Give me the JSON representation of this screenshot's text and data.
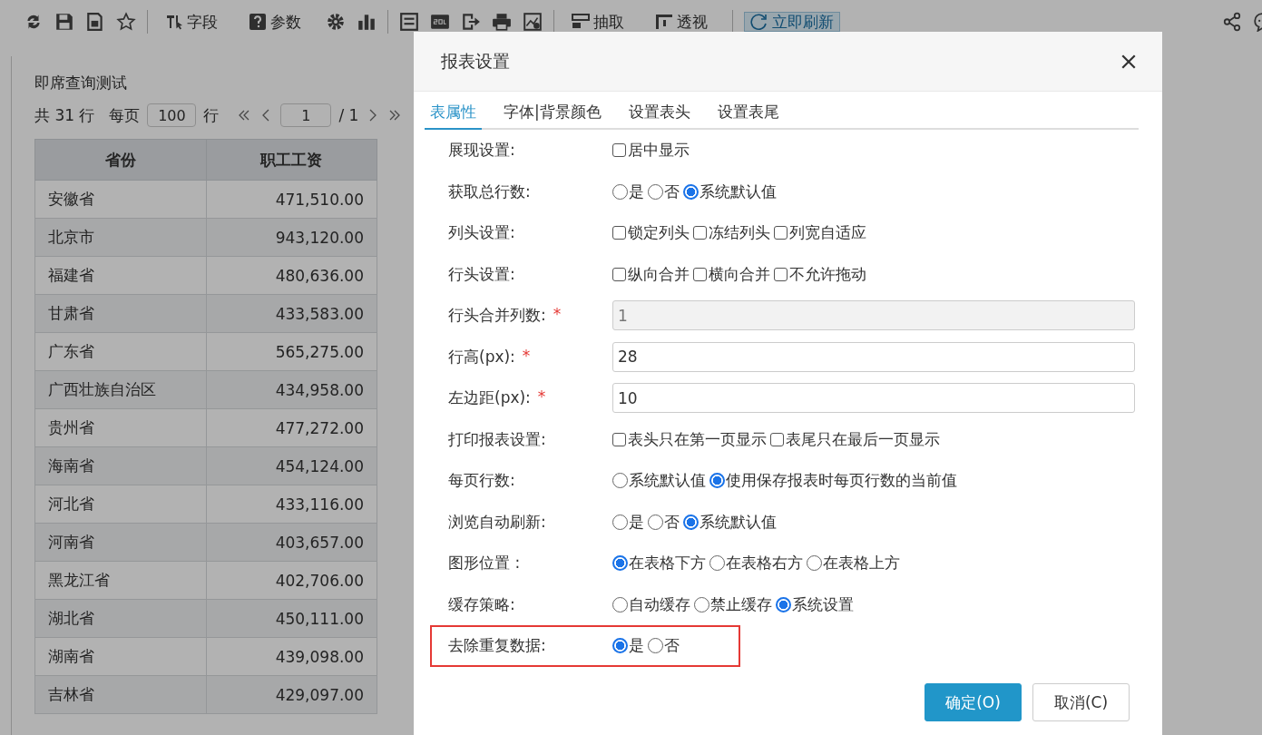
{
  "toolbar": {
    "buttons": [
      {
        "label": "字段",
        "active": false
      },
      {
        "label": "参数",
        "active": false
      },
      {
        "label": "抽取",
        "active": false
      },
      {
        "label": "透视",
        "active": false
      },
      {
        "label": "立即刷新",
        "active": true
      }
    ]
  },
  "report": {
    "title": "即席查询测试",
    "pager": {
      "total": "共 31 行",
      "per_page_label": "每页",
      "per_page": "100",
      "rows_unit": "行",
      "page": "1",
      "page_count": "/ 1"
    },
    "columns": [
      "省份",
      "职工工资"
    ],
    "rows": [
      [
        "安徽省",
        "471,510.00"
      ],
      [
        "北京市",
        "943,120.00"
      ],
      [
        "福建省",
        "480,636.00"
      ],
      [
        "甘肃省",
        "433,583.00"
      ],
      [
        "广东省",
        "565,275.00"
      ],
      [
        "广西壮族自治区",
        "434,958.00"
      ],
      [
        "贵州省",
        "477,272.00"
      ],
      [
        "海南省",
        "454,124.00"
      ],
      [
        "河北省",
        "433,116.00"
      ],
      [
        "河南省",
        "403,657.00"
      ],
      [
        "黑龙江省",
        "402,706.00"
      ],
      [
        "湖北省",
        "450,111.00"
      ],
      [
        "湖南省",
        "439,098.00"
      ],
      [
        "吉林省",
        "429,097.00"
      ]
    ]
  },
  "dialog": {
    "title": "报表设置",
    "tabs": [
      {
        "label": "表属性",
        "selected": true
      },
      {
        "label": "字体|背景颜色",
        "selected": false
      },
      {
        "label": "设置表头",
        "selected": false
      },
      {
        "label": "设置表尾",
        "selected": false
      }
    ],
    "rows": [
      {
        "label": "展现设置:",
        "highlighted": false,
        "kind": "checkboxes",
        "options": [
          {
            "label": "居中显示",
            "checked": false
          }
        ]
      },
      {
        "label": "获取总行数:",
        "highlighted": false,
        "kind": "radios",
        "options": [
          {
            "label": "是",
            "checked": false
          },
          {
            "label": "否",
            "checked": false
          },
          {
            "label": "系统默认值",
            "checked": true
          }
        ]
      },
      {
        "label": "列头设置:",
        "highlighted": false,
        "kind": "checkboxes",
        "options": [
          {
            "label": "锁定列头",
            "checked": false
          },
          {
            "label": "冻结列头",
            "checked": false
          },
          {
            "label": "列宽自适应",
            "checked": false
          }
        ]
      },
      {
        "label": "行头设置:",
        "highlighted": false,
        "kind": "checkboxes",
        "options": [
          {
            "label": "纵向合并",
            "checked": false
          },
          {
            "label": "横向合并",
            "checked": false
          },
          {
            "label": "不允许拖动",
            "checked": false
          }
        ]
      },
      {
        "label": "行头合并列数:",
        "required_mark": "*",
        "highlighted": false,
        "kind": "input",
        "value": "1",
        "disabled": true
      },
      {
        "label": "行高(px):",
        "required_mark": "*",
        "highlighted": false,
        "kind": "input",
        "value": "28",
        "disabled": false
      },
      {
        "label": "左边距(px):",
        "required_mark": "*",
        "highlighted": false,
        "kind": "input",
        "value": "10",
        "disabled": false
      },
      {
        "label": "打印报表设置:",
        "highlighted": false,
        "kind": "checkboxes",
        "options": [
          {
            "label": "表头只在第一页显示",
            "checked": false
          },
          {
            "label": "表尾只在最后一页显示",
            "checked": false
          }
        ]
      },
      {
        "label": "每页行数:",
        "highlighted": false,
        "kind": "radios",
        "options": [
          {
            "label": "系统默认值",
            "checked": false
          },
          {
            "label": "使用保存报表时每页行数的当前值",
            "checked": true
          }
        ]
      },
      {
        "label": "浏览自动刷新:",
        "highlighted": false,
        "kind": "radios",
        "options": [
          {
            "label": "是",
            "checked": false
          },
          {
            "label": "否",
            "checked": false
          },
          {
            "label": "系统默认值",
            "checked": true
          }
        ]
      },
      {
        "label": "图形位置 :",
        "highlighted": false,
        "kind": "radios",
        "options": [
          {
            "label": "在表格下方",
            "checked": true
          },
          {
            "label": "在表格右方",
            "checked": false
          },
          {
            "label": "在表格上方",
            "checked": false
          }
        ]
      },
      {
        "label": "缓存策略:",
        "highlighted": false,
        "kind": "radios",
        "options": [
          {
            "label": "自动缓存",
            "checked": false
          },
          {
            "label": "禁止缓存",
            "checked": false
          },
          {
            "label": "系统设置",
            "checked": true
          }
        ]
      },
      {
        "label": "去除重复数据:",
        "highlighted": true,
        "kind": "radios",
        "options": [
          {
            "label": "是",
            "checked": true
          },
          {
            "label": "否",
            "checked": false
          }
        ]
      }
    ],
    "buttons": [
      {
        "label": "确定(O)",
        "primary": true
      },
      {
        "label": "取消(C)",
        "primary": false
      }
    ]
  }
}
